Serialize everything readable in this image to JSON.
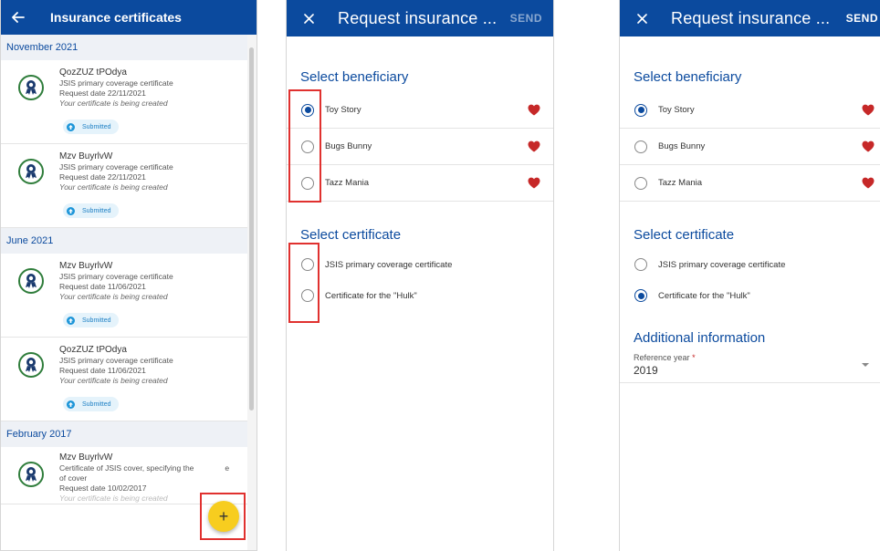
{
  "panel1": {
    "title": "Insurance certificates",
    "sections": [
      {
        "header": "November 2021",
        "items": [
          {
            "name": "QozZUZ tPOdya",
            "type": "JSIS primary coverage certificate",
            "date": "Request date 22/11/2021",
            "status": "Your certificate is being created",
            "badge": "Submitted"
          },
          {
            "name": "Mzv BuyrlvW",
            "type": "JSIS primary coverage certificate",
            "date": "Request date 22/11/2021",
            "status": "Your certificate is being created",
            "badge": "Submitted"
          }
        ]
      },
      {
        "header": "June 2021",
        "items": [
          {
            "name": "Mzv BuyrlvW",
            "type": "JSIS primary coverage certificate",
            "date": "Request date 11/06/2021",
            "status": "Your certificate is being created",
            "badge": "Submitted"
          },
          {
            "name": "QozZUZ tPOdya",
            "type": "JSIS primary coverage certificate",
            "date": "Request date 11/06/2021",
            "status": "Your certificate is being created",
            "badge": "Submitted"
          }
        ]
      },
      {
        "header": "February 2017",
        "items": [
          {
            "name": "Mzv BuyrlvW",
            "type_line1": "Certificate of JSIS cover, specifying the",
            "type_line1_tail": "e",
            "type_line2": "of cover",
            "date": "Request date 10/02/2017",
            "status": "Your certificate is being created"
          }
        ]
      }
    ],
    "fab": "+"
  },
  "panel2": {
    "title": "Request insurance ...",
    "send": "SEND",
    "beneficiary_title": "Select beneficiary",
    "beneficiaries": [
      {
        "label": "Toy Story",
        "selected": true
      },
      {
        "label": "Bugs Bunny",
        "selected": false
      },
      {
        "label": "Tazz Mania",
        "selected": false
      }
    ],
    "certificate_title": "Select certificate",
    "certificates": [
      {
        "label": "JSIS primary coverage certificate",
        "selected": false
      },
      {
        "label": "Certificate for the \"Hulk\"",
        "selected": false
      }
    ]
  },
  "panel3": {
    "title": "Request insurance ...",
    "send": "SEND",
    "beneficiary_title": "Select beneficiary",
    "beneficiaries": [
      {
        "label": "Toy Story",
        "selected": true
      },
      {
        "label": "Bugs Bunny",
        "selected": false
      },
      {
        "label": "Tazz Mania",
        "selected": false
      }
    ],
    "certificate_title": "Select certificate",
    "certificates": [
      {
        "label": "JSIS primary coverage certificate",
        "selected": false
      },
      {
        "label": "Certificate for the \"Hulk\"",
        "selected": true
      }
    ],
    "additional_title": "Additional information",
    "reference_label": "Reference year",
    "reference_required": "*",
    "reference_value": "2019"
  },
  "colors": {
    "appbar": "#0b4a9e",
    "accent": "#0b4a9e",
    "heart": "#c62828",
    "fab": "#f7cd1f",
    "highlight": "#e0312f",
    "badge": "#1c95d8"
  }
}
